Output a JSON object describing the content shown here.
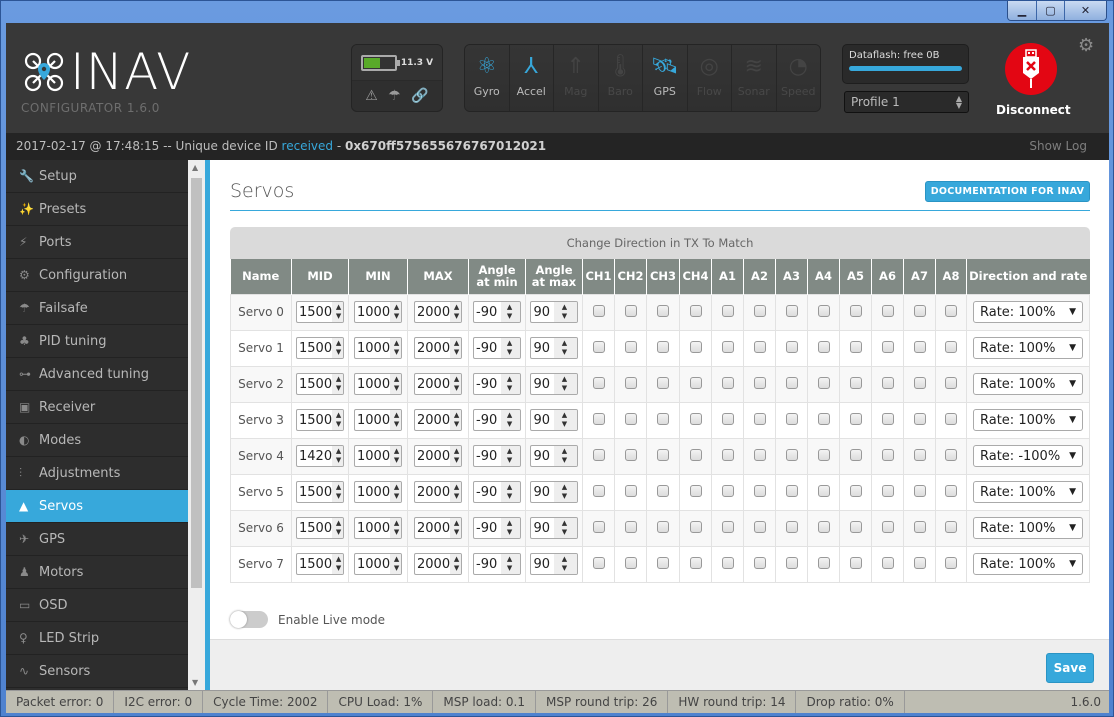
{
  "window": {
    "controls": {
      "minimize": "▁",
      "maximize": "▢",
      "close": "✕"
    }
  },
  "header": {
    "logo_text": "INAV",
    "logo_sub": "CONFIGURATOR  1.6.0",
    "battery": {
      "voltage": "11.3 V",
      "level_percent": 55
    },
    "status_icons": [
      "warning-icon",
      "parachute-icon",
      "link-icon"
    ],
    "sensors": [
      {
        "label": "Gyro",
        "icon": "gyro-icon",
        "active": true
      },
      {
        "label": "Accel",
        "icon": "accel-icon",
        "active": true
      },
      {
        "label": "Mag",
        "icon": "mag-icon",
        "active": false
      },
      {
        "label": "Baro",
        "icon": "baro-icon",
        "active": false
      },
      {
        "label": "GPS",
        "icon": "gps-icon",
        "active": true
      },
      {
        "label": "Flow",
        "icon": "flow-icon",
        "active": false
      },
      {
        "label": "Sonar",
        "icon": "sonar-icon",
        "active": false
      },
      {
        "label": "Speed",
        "icon": "speed-icon",
        "active": false
      }
    ],
    "dataflash": {
      "label": "Dataflash: free 0B",
      "fill_percent": 100
    },
    "profile": "Profile 1",
    "disconnect_label": "Disconnect"
  },
  "log": {
    "prefix": "2017-02-17 @ 17:48:15 -- Unique device ID ",
    "received": "received",
    "separator": " - ",
    "device_id": "0x670ff575655676767012021",
    "show_log": "Show Log"
  },
  "sidebar": {
    "items": [
      {
        "label": "Setup",
        "icon": "wrench-icon",
        "glyph": "🔧"
      },
      {
        "label": "Presets",
        "icon": "magic-wand-icon",
        "glyph": "✨"
      },
      {
        "label": "Ports",
        "icon": "plug-icon",
        "glyph": "⚡"
      },
      {
        "label": "Configuration",
        "icon": "gear-icon",
        "glyph": "⚙"
      },
      {
        "label": "Failsafe",
        "icon": "parachute-icon",
        "glyph": "☂"
      },
      {
        "label": "PID tuning",
        "icon": "hierarchy-icon",
        "glyph": "♣"
      },
      {
        "label": "Advanced tuning",
        "icon": "advanced-icon",
        "glyph": "⊶"
      },
      {
        "label": "Receiver",
        "icon": "receiver-icon",
        "glyph": "▣"
      },
      {
        "label": "Modes",
        "icon": "toggle-icon",
        "glyph": "◐"
      },
      {
        "label": "Adjustments",
        "icon": "sliders-icon",
        "glyph": "⫶"
      },
      {
        "label": "Servos",
        "icon": "servo-icon",
        "glyph": "▲",
        "active": true
      },
      {
        "label": "GPS",
        "icon": "satellite-icon",
        "glyph": "✈"
      },
      {
        "label": "Motors",
        "icon": "motor-icon",
        "glyph": "♟"
      },
      {
        "label": "OSD",
        "icon": "osd-icon",
        "glyph": "▭"
      },
      {
        "label": "LED Strip",
        "icon": "led-icon",
        "glyph": "♀"
      },
      {
        "label": "Sensors",
        "icon": "pulse-icon",
        "glyph": "∿"
      }
    ]
  },
  "main": {
    "title": "Servos",
    "doc_button": "DOCUMENTATION FOR INAV",
    "table": {
      "caption": "Change Direction in TX To Match",
      "columns": [
        "Name",
        "MID",
        "MIN",
        "MAX",
        "Angle at min",
        "Angle at max",
        "CH1",
        "CH2",
        "CH3",
        "CH4",
        "A1",
        "A2",
        "A3",
        "A4",
        "A5",
        "A6",
        "A7",
        "A8",
        "Direction and rate"
      ],
      "rows": [
        {
          "name": "Servo 0",
          "mid": "1500",
          "min": "1000",
          "max": "2000",
          "angle_min": "-90",
          "angle_max": "90",
          "rate": "Rate: 100%"
        },
        {
          "name": "Servo 1",
          "mid": "1500",
          "min": "1000",
          "max": "2000",
          "angle_min": "-90",
          "angle_max": "90",
          "rate": "Rate: 100%"
        },
        {
          "name": "Servo 2",
          "mid": "1500",
          "min": "1000",
          "max": "2000",
          "angle_min": "-90",
          "angle_max": "90",
          "rate": "Rate: 100%"
        },
        {
          "name": "Servo 3",
          "mid": "1500",
          "min": "1000",
          "max": "2000",
          "angle_min": "-90",
          "angle_max": "90",
          "rate": "Rate: 100%"
        },
        {
          "name": "Servo 4",
          "mid": "1420",
          "min": "1000",
          "max": "2000",
          "angle_min": "-90",
          "angle_max": "90",
          "rate": "Rate: -100%"
        },
        {
          "name": "Servo 5",
          "mid": "1500",
          "min": "1000",
          "max": "2000",
          "angle_min": "-90",
          "angle_max": "90",
          "rate": "Rate: 100%"
        },
        {
          "name": "Servo 6",
          "mid": "1500",
          "min": "1000",
          "max": "2000",
          "angle_min": "-90",
          "angle_max": "90",
          "rate": "Rate: 100%"
        },
        {
          "name": "Servo 7",
          "mid": "1500",
          "min": "1000",
          "max": "2000",
          "angle_min": "-90",
          "angle_max": "90",
          "rate": "Rate: 100%"
        }
      ]
    },
    "live_mode_label": "Enable Live mode",
    "live_mode_on": false,
    "save_label": "Save"
  },
  "status": {
    "packet_error": "Packet error: 0",
    "i2c_error": "I2C error: 0",
    "cycle_time": "Cycle Time: 2002",
    "cpu_load": "CPU Load: 1%",
    "msp_load": "MSP load: 0.1",
    "msp_round_trip": "MSP round trip: 26",
    "hw_round_trip": "HW round trip: 14",
    "drop_ratio": "Drop ratio: 0%",
    "version": "1.6.0"
  }
}
